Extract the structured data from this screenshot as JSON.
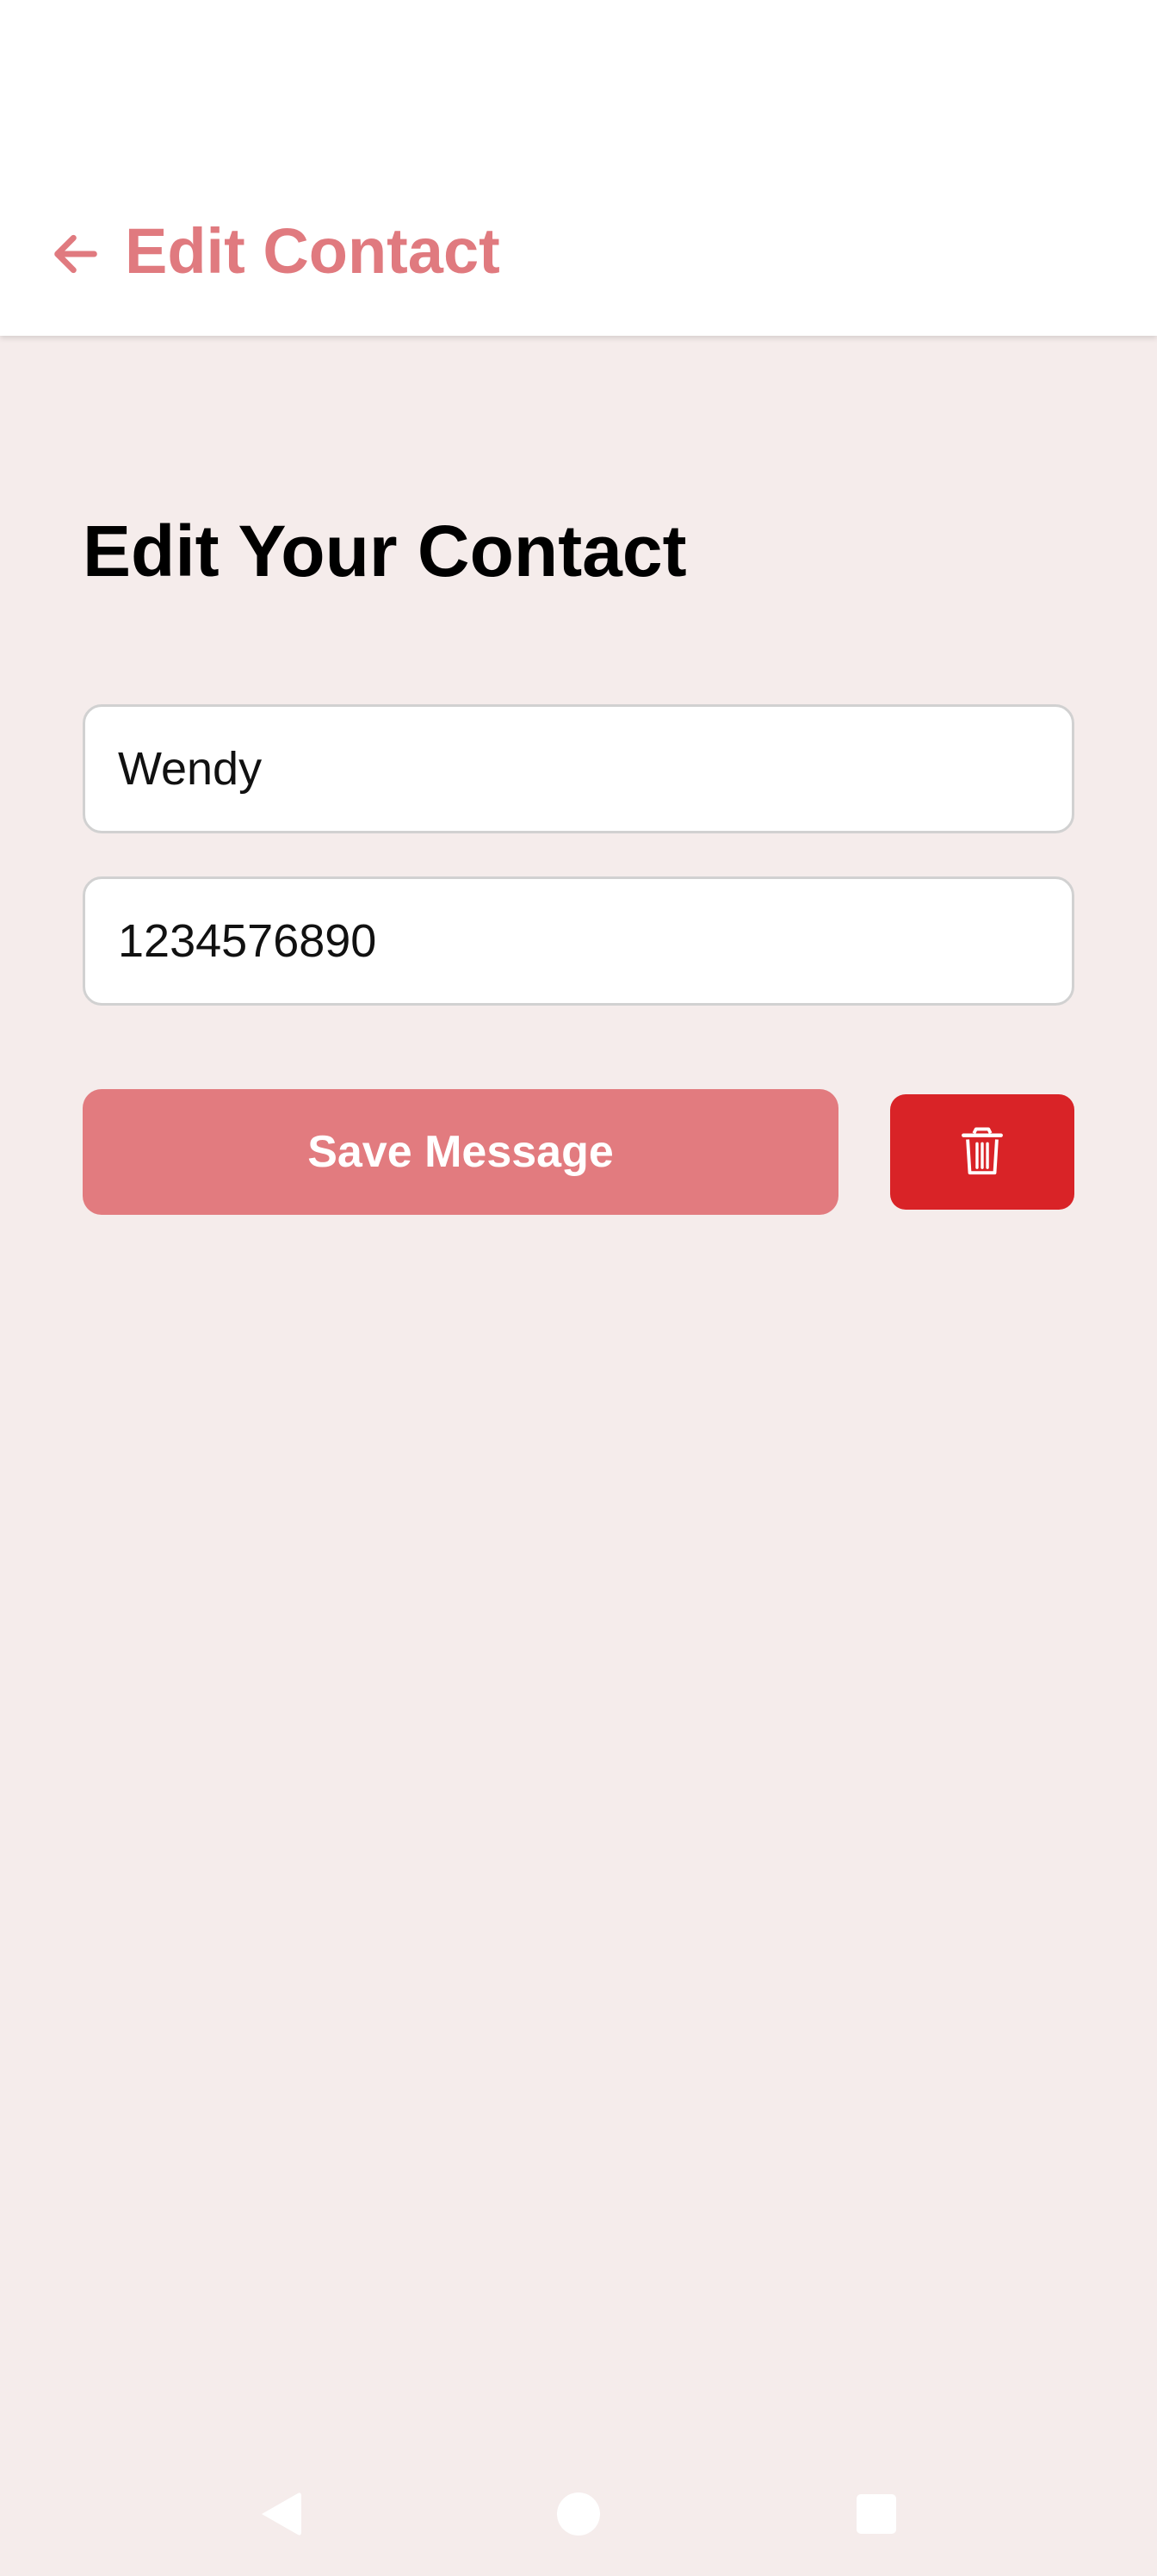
{
  "app_bar": {
    "title": "Edit Contact",
    "back_icon": "arrow-left-icon"
  },
  "form": {
    "heading": "Edit Your Contact",
    "name_value": "Wendy",
    "phone_value": "1234576890",
    "save_label": "Save Message",
    "delete_icon": "trash-icon"
  },
  "nav_bar": {
    "back_icon": "triangle-back-icon",
    "home_icon": "circle-home-icon",
    "recents_icon": "square-recents-icon"
  },
  "colors": {
    "accent": "#e07a7f",
    "danger": "#d92327",
    "background": "#f5eceb"
  }
}
